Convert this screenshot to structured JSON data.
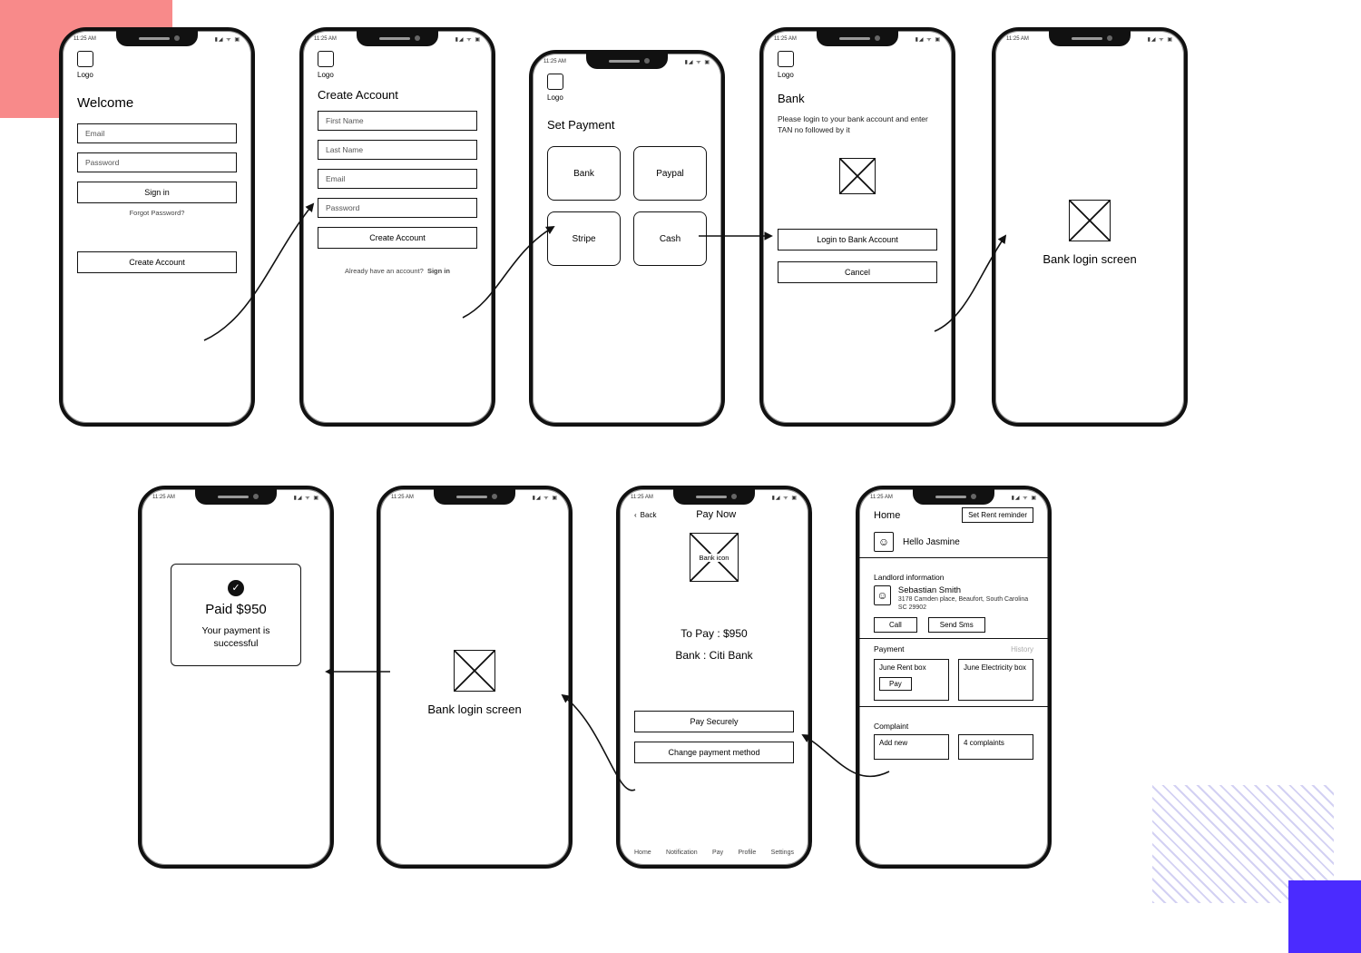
{
  "status": {
    "time": "11:25 AM",
    "icons": "▮◢ ᯤ ▣"
  },
  "logo_label": "Logo",
  "welcome": {
    "title": "Welcome",
    "email": "Email",
    "password": "Password",
    "signin": "Sign in",
    "forgot": "Forgot Password?",
    "create": "Create Account"
  },
  "create": {
    "title": "Create Account",
    "first": "First Name",
    "last": "Last Name",
    "email": "Email",
    "password": "Password",
    "btn": "Create Account",
    "already": "Already have an account?",
    "signin": "Sign in"
  },
  "setpay": {
    "title": "Set Payment",
    "tiles": [
      "Bank",
      "Paypal",
      "Stripe",
      "Cash"
    ]
  },
  "bank": {
    "title": "Bank",
    "instructions": "Please login to your bank account and enter TAN no followed by it",
    "login_btn": "Login to Bank Account",
    "cancel": "Cancel"
  },
  "banklogin_label": "Bank login screen",
  "success": {
    "amount": "Paid $950",
    "msg": "Your payment is successful"
  },
  "paynow": {
    "back": "Back",
    "title": "Pay Now",
    "icon_label": "Bank icon",
    "to_pay": "To Pay : $950",
    "bank": "Bank : Citi Bank",
    "pay_btn": "Pay Securely",
    "change_btn": "Change payment method",
    "nav": [
      "Home",
      "Notification",
      "Pay",
      "Profile",
      "Settings"
    ]
  },
  "home": {
    "title": "Home",
    "reminder_btn": "Set Rent reminder",
    "greeting": "Hello Jasmine",
    "landlord_section": "Landlord information",
    "landlord_name": "Sebastian Smith",
    "landlord_addr": "3178 Camden place, Beaufort, South Carolina SC 29902",
    "call": "Call",
    "sms": "Send Sms",
    "payment_section": "Payment",
    "history": "History",
    "card1": "June Rent box",
    "card1_btn": "Pay",
    "card2": "June Electricity box",
    "complaint_section": "Complaint",
    "complaint_new": "Add new",
    "complaint_count": "4 complaints"
  }
}
